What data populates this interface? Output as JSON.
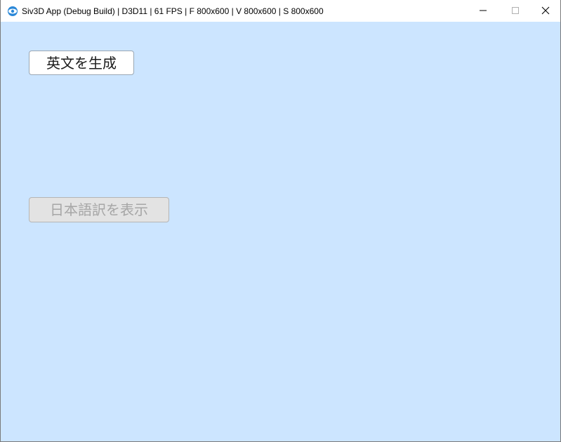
{
  "window": {
    "title": "Siv3D App (Debug Build) | D3D11 | 61 FPS | F 800x600 | V 800x600 | S 800x600",
    "icon": "siv3d-app-icon",
    "controls": {
      "minimize_icon": "minimize-icon",
      "maximize_icon": "maximize-icon",
      "close_icon": "close-icon"
    }
  },
  "client": {
    "background_color": "#cce5ff",
    "generate_button": {
      "label": "英文を生成",
      "enabled": true
    },
    "translate_button": {
      "label": "日本語訳を表示",
      "enabled": false
    }
  }
}
